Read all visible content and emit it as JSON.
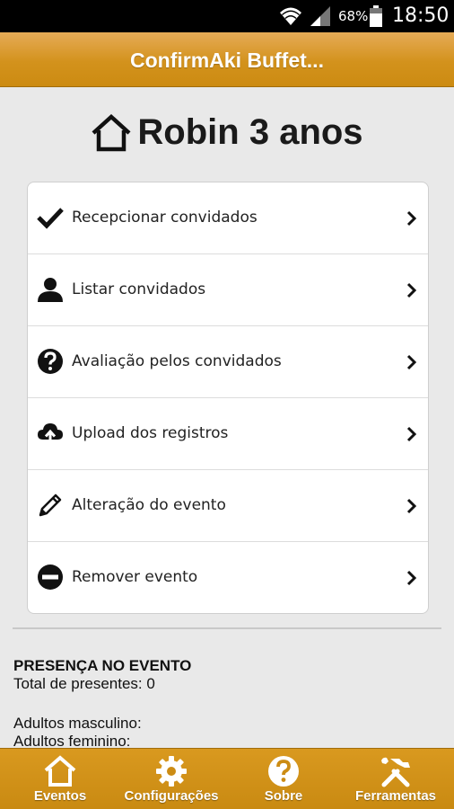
{
  "status_bar": {
    "battery_percent": "68%",
    "time": "18:50",
    "icons": [
      "wifi-icon",
      "signal-icon",
      "battery-icon"
    ]
  },
  "app_bar": {
    "title": "ConfirmAki Buffet..."
  },
  "event": {
    "icon": "home-icon",
    "title": "Robin 3 anos"
  },
  "menu": {
    "items": [
      {
        "icon": "check-icon",
        "label": "Recepcionar convidados"
      },
      {
        "icon": "person-icon",
        "label": "Listar convidados"
      },
      {
        "icon": "question-icon",
        "label": "Avaliação pelos convidados"
      },
      {
        "icon": "cloud-upload-icon",
        "label": "Upload dos registros"
      },
      {
        "icon": "pencil-icon",
        "label": "Alteração do evento"
      },
      {
        "icon": "minus-circle-icon",
        "label": "Remover evento"
      }
    ]
  },
  "presence": {
    "heading": "PRESENÇA NO EVENTO",
    "total_label": "Total de presentes: 0",
    "adults_male_label": "Adultos masculino:",
    "adults_female_label": "Adultos feminino:"
  },
  "bottom_nav": {
    "items": [
      {
        "icon": "home-icon",
        "label": "Eventos"
      },
      {
        "icon": "gear-icon",
        "label": "Configurações"
      },
      {
        "icon": "question-icon",
        "label": "Sobre"
      },
      {
        "icon": "tools-icon",
        "label": "Ferramentas"
      }
    ]
  },
  "colors": {
    "accent": "#d3921c",
    "background": "#e9e9e9"
  }
}
